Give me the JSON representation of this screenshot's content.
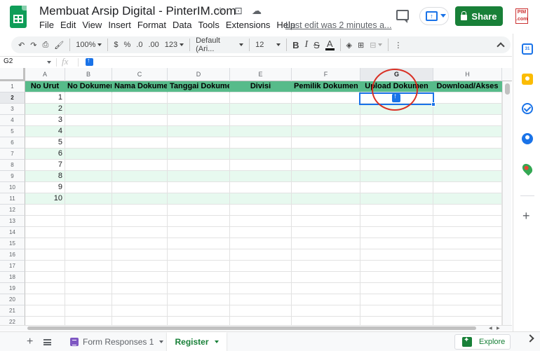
{
  "header": {
    "doc_title": "Membuat Arsip Digital - PinterIM.com",
    "menu": [
      "File",
      "Edit",
      "View",
      "Insert",
      "Format",
      "Data",
      "Tools",
      "Extensions",
      "Help"
    ],
    "last_edit": "Last edit was 2 minutes a...",
    "share_label": "Share",
    "site_logo_text": "PIM .com"
  },
  "toolbar": {
    "zoom": "100%",
    "currency": "$",
    "percent": "%",
    "dec_decrease": ".0",
    "dec_increase": ".00",
    "more_formats": "123",
    "font": "Default (Ari...",
    "font_size": "12",
    "bold": "B",
    "italic": "I",
    "strike": "S",
    "text_color": "A",
    "more": "⋮"
  },
  "formula_bar": {
    "name_box": "G2",
    "fx": "fx"
  },
  "grid": {
    "columns": [
      "A",
      "B",
      "C",
      "D",
      "E",
      "F",
      "G",
      "H"
    ],
    "selected_column": "G",
    "selected_row": "2",
    "header_row": [
      "No Urut",
      "No Dokumen",
      "Nama Dokumen",
      "Tanggai Dokumen",
      "Divisi",
      "Pemilik Dokumen",
      "Upload Dokumen",
      "Download/Akses"
    ],
    "row_numbers": [
      "1",
      "2",
      "3",
      "4",
      "5",
      "6",
      "7",
      "8",
      "9",
      "10",
      "11",
      "12",
      "13",
      "14",
      "15",
      "16",
      "17",
      "18",
      "19",
      "20",
      "21",
      "22"
    ],
    "no_urut": [
      "1",
      "2",
      "3",
      "4",
      "5",
      "6",
      "7",
      "8",
      "9",
      "10"
    ]
  },
  "sheets": {
    "tabs": [
      {
        "label": "Form Responses 1"
      },
      {
        "label": "Register"
      }
    ],
    "explore_label": "Explore"
  },
  "side_panel": {
    "calendar_label": "31"
  },
  "colors": {
    "header_green": "#57bb8a",
    "band_green": "#e7f9ef",
    "selection_blue": "#1a73e8",
    "annotation_red": "#d93025",
    "share_green": "#188038"
  }
}
